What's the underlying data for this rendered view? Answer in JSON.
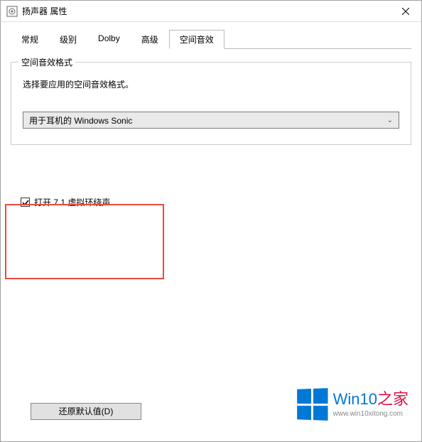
{
  "window": {
    "title": "扬声器 属性"
  },
  "tabs": {
    "items": [
      {
        "label": "常规"
      },
      {
        "label": "级别"
      },
      {
        "label": "Dolby"
      },
      {
        "label": "高级"
      },
      {
        "label": "空间音效"
      }
    ],
    "active_index": 4
  },
  "groupbox": {
    "title": "空间音效格式",
    "description": "选择要应用的空间音效格式。"
  },
  "dropdown": {
    "selected": "用于耳机的 Windows Sonic"
  },
  "checkbox": {
    "label": "打开 7.1 虚拟环绕声",
    "checked": true
  },
  "buttons": {
    "restore_defaults": "还原默认值(D)"
  },
  "watermark": {
    "brand_prefix": "Win10",
    "brand_suffix": "之家",
    "url": "www.win10xitong.com"
  }
}
